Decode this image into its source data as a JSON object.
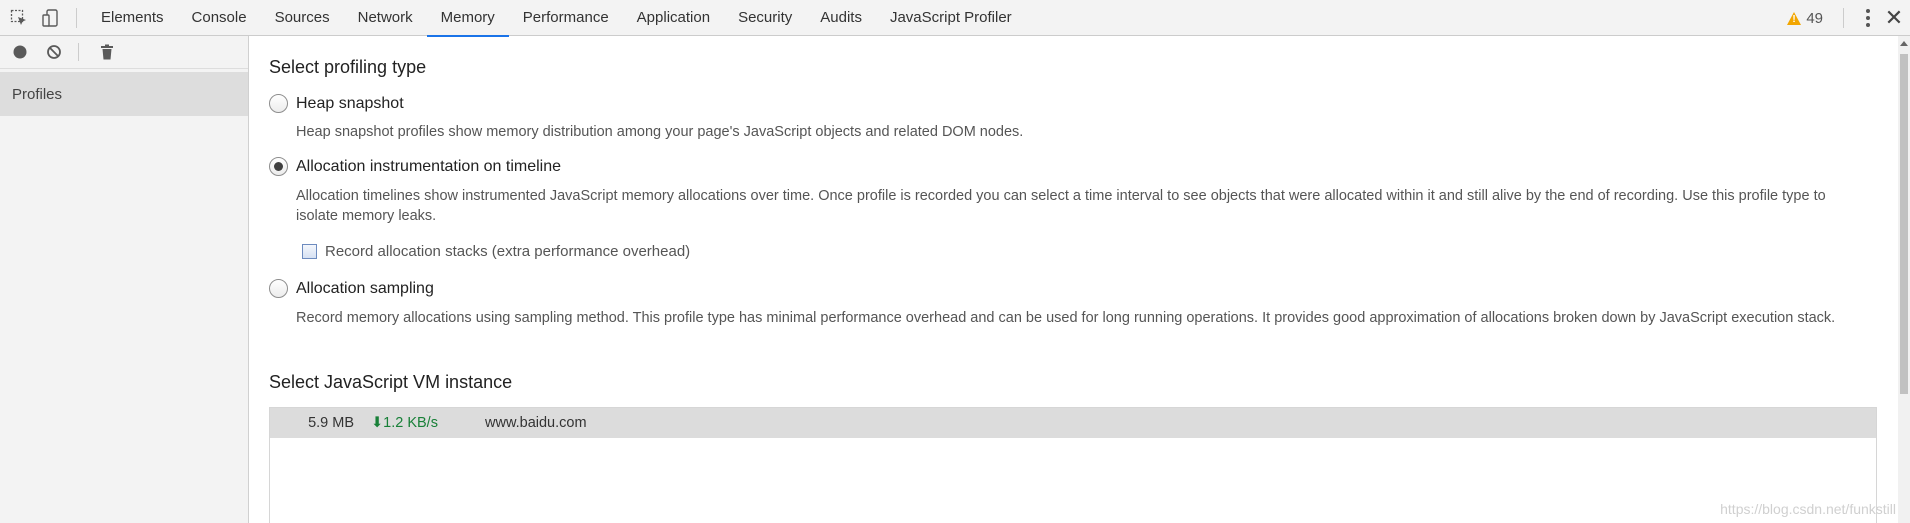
{
  "toolbar": {
    "tabs": [
      "Elements",
      "Console",
      "Sources",
      "Network",
      "Memory",
      "Performance",
      "Application",
      "Security",
      "Audits",
      "JavaScript Profiler"
    ],
    "active_tab": "Memory",
    "warning_count": "49",
    "close_label": "✕"
  },
  "sidebar": {
    "items": [
      {
        "label": "Profiles"
      }
    ]
  },
  "main": {
    "profiling_heading": "Select profiling type",
    "options": [
      {
        "label": "Heap snapshot",
        "description": "Heap snapshot profiles show memory distribution among your page's JavaScript objects and related DOM nodes.",
        "checked": false
      },
      {
        "label": "Allocation instrumentation on timeline",
        "description": "Allocation timelines show instrumented JavaScript memory allocations over time. Once profile is recorded you can select a time interval to see objects that were allocated within it and still alive by the end of recording. Use this profile type to isolate memory leaks.",
        "checked": true
      },
      {
        "label": "Allocation sampling",
        "description": "Record memory allocations using sampling method. This profile type has minimal performance overhead and can be used for long running operations. It provides good approximation of allocations broken down by JavaScript execution stack.",
        "checked": false
      }
    ],
    "record_stacks_label": "Record allocation stacks (extra performance overhead)",
    "vm_heading": "Select JavaScript VM instance",
    "vm_instances": [
      {
        "size": "5.9 MB",
        "rate": "⬇1.2 KB/s",
        "url": "www.baidu.com"
      }
    ]
  },
  "watermark": "https://blog.csdn.net/funkstill",
  "colors": {
    "accent": "#1a73e8",
    "warning": "#f2a600",
    "rate": "#188038"
  }
}
